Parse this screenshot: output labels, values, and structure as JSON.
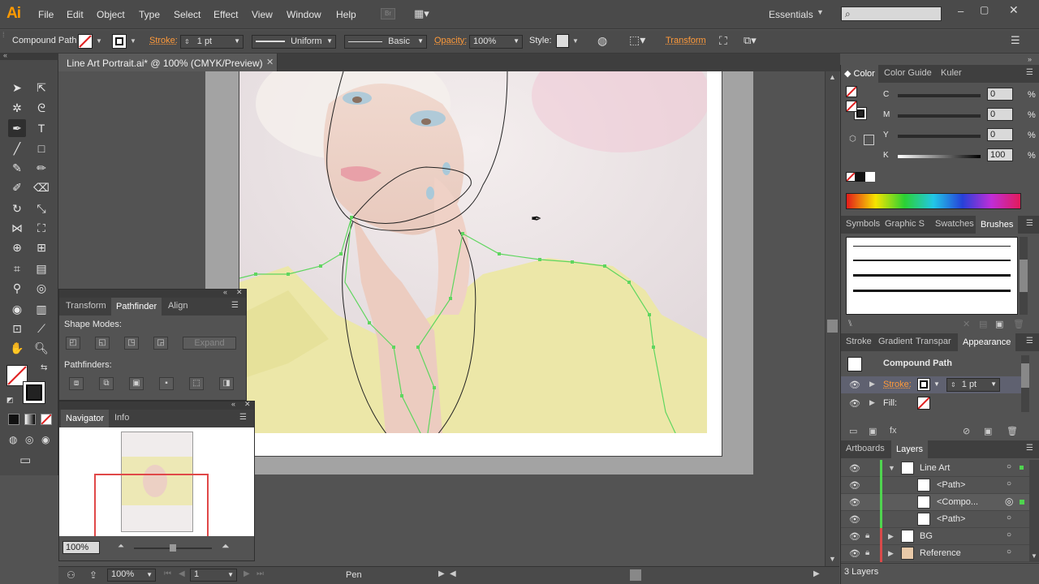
{
  "app": {
    "logo": "Ai",
    "workspace": "Essentials",
    "search_placeholder": ""
  },
  "menu": [
    "File",
    "Edit",
    "Object",
    "Type",
    "Select",
    "Effect",
    "View",
    "Window",
    "Help"
  ],
  "control_bar": {
    "selection": "Compound Path",
    "stroke_label": "Stroke:",
    "stroke_weight": "1 pt",
    "profile": "Uniform",
    "brush": "Basic",
    "opacity_label": "Opacity:",
    "opacity": "100%",
    "style_label": "Style:",
    "transform_label": "Transform"
  },
  "document": {
    "tab_title": "Line Art Portrait.ai* @ 100% (CMYK/Preview)"
  },
  "pathfinder_panel": {
    "tabs": [
      "Transform",
      "Pathfinder",
      "Align"
    ],
    "active_tab": "Pathfinder",
    "shape_modes_label": "Shape Modes:",
    "expand_label": "Expand",
    "pathfinders_label": "Pathfinders:"
  },
  "navigator_panel": {
    "tabs": [
      "Navigator",
      "Info"
    ],
    "zoom": "100%"
  },
  "color_panel": {
    "tabs": [
      "Color",
      "Color Guide",
      "Kuler"
    ],
    "channels": [
      {
        "name": "C",
        "value": "0",
        "unit": "%"
      },
      {
        "name": "M",
        "value": "0",
        "unit": "%"
      },
      {
        "name": "Y",
        "value": "0",
        "unit": "%"
      },
      {
        "name": "K",
        "value": "100",
        "unit": "%"
      }
    ]
  },
  "brushes_panel": {
    "tabs": [
      "Symbols",
      "Graphic S",
      "Swatches",
      "Brushes"
    ],
    "active_tab": "Brushes"
  },
  "appearance_panel": {
    "tabs": [
      "Stroke",
      "Gradient",
      "Transpar",
      "Appearance"
    ],
    "active_tab": "Appearance",
    "title": "Compound Path",
    "stroke_label": "Stroke:",
    "stroke_weight": "1 pt",
    "fill_label": "Fill:"
  },
  "layers_panel": {
    "tabs": [
      "Artboards",
      "Layers"
    ],
    "active_tab": "Layers",
    "rows": [
      {
        "name": "Line Art",
        "level": 0,
        "expanded": true,
        "color": "#4fd44f",
        "locked": false
      },
      {
        "name": "<Path>",
        "level": 1,
        "color": "#4fd44f",
        "locked": false
      },
      {
        "name": "<Compo...",
        "level": 1,
        "color": "#4fd44f",
        "locked": false,
        "selected": true
      },
      {
        "name": "<Path>",
        "level": 1,
        "color": "#4fd44f",
        "locked": false
      },
      {
        "name": "BG",
        "level": 0,
        "expanded": false,
        "color": "#d94a4a",
        "locked": true
      },
      {
        "name": "Reference",
        "level": 0,
        "expanded": false,
        "color": "#d94a4a",
        "locked": true
      }
    ],
    "count": "3 Layers"
  },
  "status_bar": {
    "zoom": "100%",
    "artboard_number": "1",
    "tool": "Pen"
  },
  "colors": {
    "accent_orange": "#ff9a3a",
    "path_green": "#4fd44f",
    "logo_orange": "#ff9a00"
  }
}
